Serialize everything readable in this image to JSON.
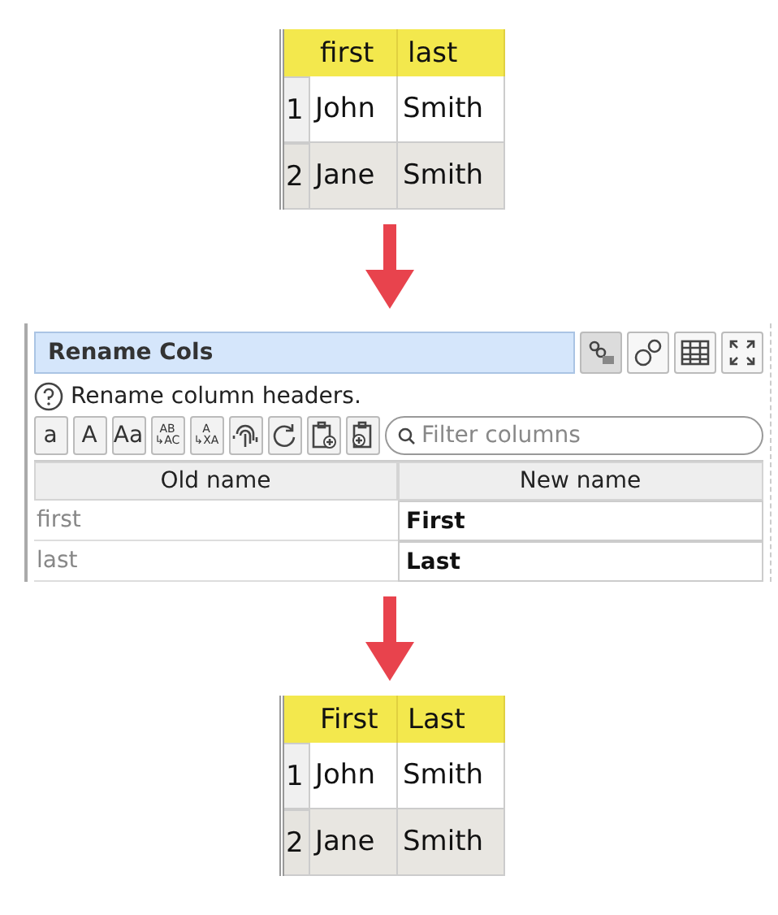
{
  "input_table": {
    "columns": [
      "first",
      "last"
    ],
    "rows": [
      {
        "number": "1",
        "cells": [
          "John",
          "Smith"
        ]
      },
      {
        "number": "2",
        "cells": [
          "Jane",
          "Smith"
        ]
      }
    ]
  },
  "panel": {
    "title": "Rename Cols",
    "help": "Rename column headers.",
    "header_buttons": [
      {
        "kind": "nodes"
      },
      {
        "kind": "gears"
      },
      {
        "kind": "table"
      },
      {
        "kind": "expand"
      }
    ],
    "tools": [
      {
        "kind": "text",
        "label": "a"
      },
      {
        "kind": "text",
        "label": "A"
      },
      {
        "kind": "text",
        "label": "Aa"
      },
      {
        "kind": "stack",
        "label": "AB",
        "sublabel": "↳AC"
      },
      {
        "kind": "stack",
        "label": "A",
        "sublabel": "↳XA"
      },
      {
        "kind": "fingerprint"
      },
      {
        "kind": "refresh"
      },
      {
        "kind": "paste-in"
      },
      {
        "kind": "paste-out"
      }
    ],
    "filter": {
      "placeholder": "Filter columns"
    },
    "columns": [
      "Old name",
      "New name"
    ],
    "rows": [
      {
        "old": "first",
        "new": "First"
      },
      {
        "old": "last",
        "new": "Last"
      }
    ]
  },
  "output_table": {
    "columns": [
      "First",
      "Last"
    ],
    "rows": [
      {
        "number": "1",
        "cells": [
          "John",
          "Smith"
        ]
      },
      {
        "number": "2",
        "cells": [
          "Jane",
          "Smith"
        ]
      }
    ]
  }
}
